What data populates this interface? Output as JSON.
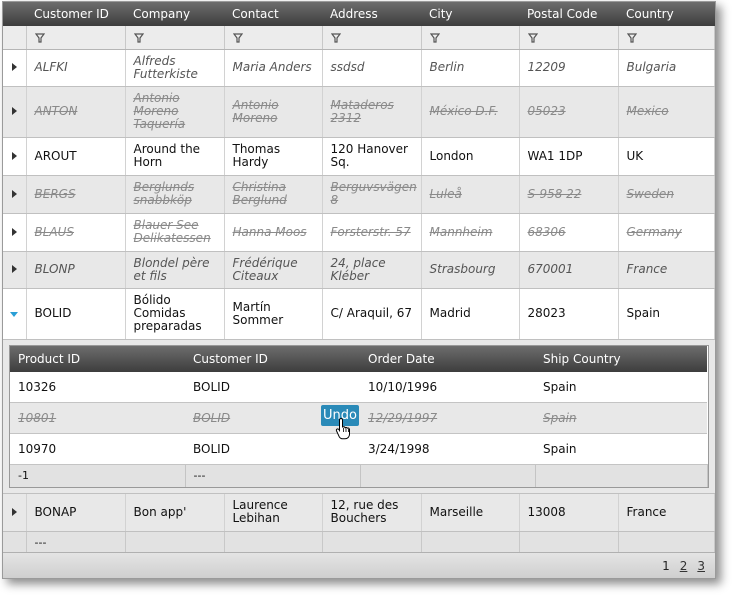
{
  "columns": [
    "Customer ID",
    "Company",
    "Contact",
    "Address",
    "City",
    "Postal Code",
    "Country"
  ],
  "filter_icon": "funnel-icon",
  "rows": [
    {
      "id": "ALFKI",
      "company": "Alfreds Futterkiste",
      "contact": "Maria Anders",
      "address": "ssdsd",
      "city": "Berlin",
      "postal": "12209",
      "country": "Bulgaria",
      "state": "modified"
    },
    {
      "id": "ANTON",
      "company": "Antonio Moreno Taquería",
      "contact": "Antonio Moreno",
      "address": "Mataderos 2312",
      "city": "México D.F.",
      "postal": "05023",
      "country": "Mexico",
      "state": "deleted"
    },
    {
      "id": "AROUT",
      "company": "Around the Horn",
      "contact": "Thomas Hardy",
      "address": "120 Hanover Sq.",
      "city": "London",
      "postal": "WA1 1DP",
      "country": "UK",
      "state": "normal"
    },
    {
      "id": "BERGS",
      "company": "Berglunds snabbköp",
      "contact": "Christina Berglund",
      "address": "Berguvsvägen 8",
      "city": "Luleå",
      "postal": "S-958 22",
      "country": "Sweden",
      "state": "deleted"
    },
    {
      "id": "BLAUS",
      "company": "Blauer See Delikatessen",
      "contact": "Hanna Moos",
      "address": "Forsterstr. 57",
      "city": "Mannheim",
      "postal": "68306",
      "country": "Germany",
      "state": "deleted"
    },
    {
      "id": "BLONP",
      "company": "Blondel père et fils",
      "contact": "Frédérique Citeaux",
      "address": "24, place Kléber",
      "city": "Strasbourg",
      "postal": "670001",
      "country": "France",
      "state": "modified"
    },
    {
      "id": "BOLID",
      "company": "Bólido Comidas preparadas",
      "contact": "Martín Sommer",
      "address": "C/ Araquil, 67",
      "city": "Madrid",
      "postal": "28023",
      "country": "Spain",
      "state": "normal",
      "expanded": true
    }
  ],
  "detail": {
    "columns": [
      "Product ID",
      "Customer ID",
      "Order Date",
      "Ship Country"
    ],
    "rows": [
      {
        "product": "10326",
        "customer": "BOLID",
        "date": "10/10/1996",
        "ship": "Spain",
        "state": "normal"
      },
      {
        "product": "10801",
        "customer": "BOLID",
        "date": "12/29/1997",
        "ship": "Spain",
        "state": "deleted"
      },
      {
        "product": "10970",
        "customer": "BOLID",
        "date": "3/24/1998",
        "ship": "Spain",
        "state": "normal"
      }
    ],
    "footer": [
      "-1",
      "---",
      "",
      ""
    ],
    "undo_label": "Undo"
  },
  "last_row": {
    "id": "BONAP",
    "company": "Bon app'",
    "contact": "Laurence Lebihan",
    "address": "12, rue des Bouchers",
    "city": "Marseille",
    "postal": "13008",
    "country": "France"
  },
  "footer": [
    "---"
  ],
  "pager": {
    "current": "1",
    "pages": [
      "2",
      "3"
    ]
  }
}
